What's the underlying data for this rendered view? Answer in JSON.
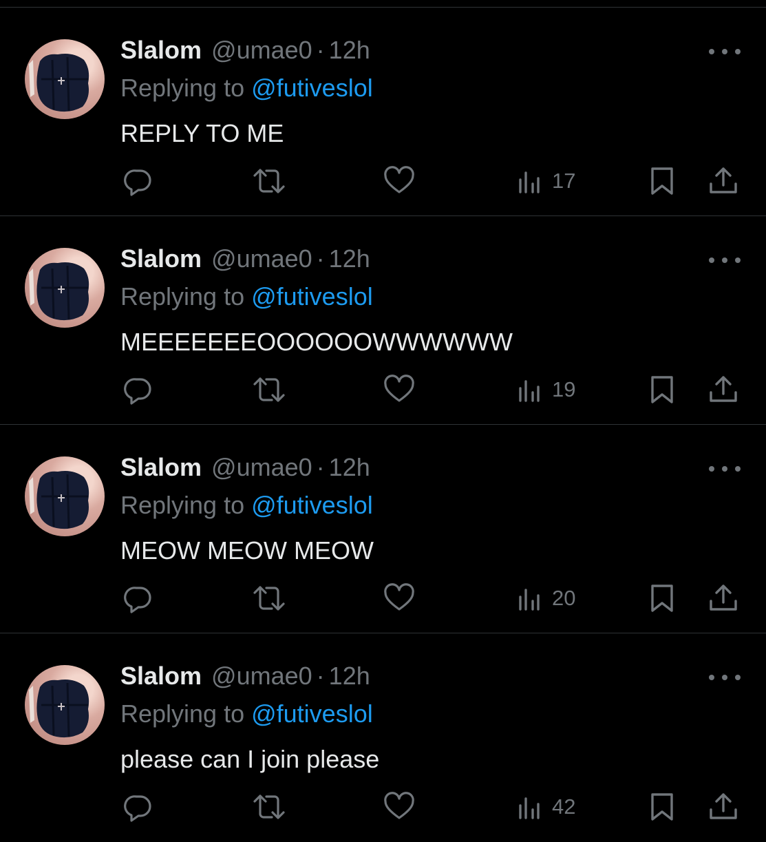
{
  "colors": {
    "background": "#000000",
    "text": "#e7e9ea",
    "muted": "#71767b",
    "link": "#1d9bf0",
    "divider": "#2f3336"
  },
  "tweets": [
    {
      "name": "Slalom",
      "handle": "@umae0",
      "separator": "·",
      "time": "12h",
      "replying_prefix": "Replying to ",
      "replying_to": "@futiveslol",
      "text": "REPLY TO ME",
      "views": "17"
    },
    {
      "name": "Slalom",
      "handle": "@umae0",
      "separator": "·",
      "time": "12h",
      "replying_prefix": "Replying to ",
      "replying_to": "@futiveslol",
      "text": "MEEEEEEEOOOOOOWWWWWW",
      "views": "19"
    },
    {
      "name": "Slalom",
      "handle": "@umae0",
      "separator": "·",
      "time": "12h",
      "replying_prefix": "Replying to ",
      "replying_to": "@futiveslol",
      "text": "MEOW MEOW MEOW",
      "views": "20"
    },
    {
      "name": "Slalom",
      "handle": "@umae0",
      "separator": "·",
      "time": "12h",
      "replying_prefix": "Replying to ",
      "replying_to": "@futiveslol",
      "text": "please can I join please",
      "views": "42"
    }
  ],
  "icons": [
    "more-icon",
    "reply-icon",
    "retweet-icon",
    "like-icon",
    "views-icon",
    "bookmark-icon",
    "share-icon"
  ]
}
